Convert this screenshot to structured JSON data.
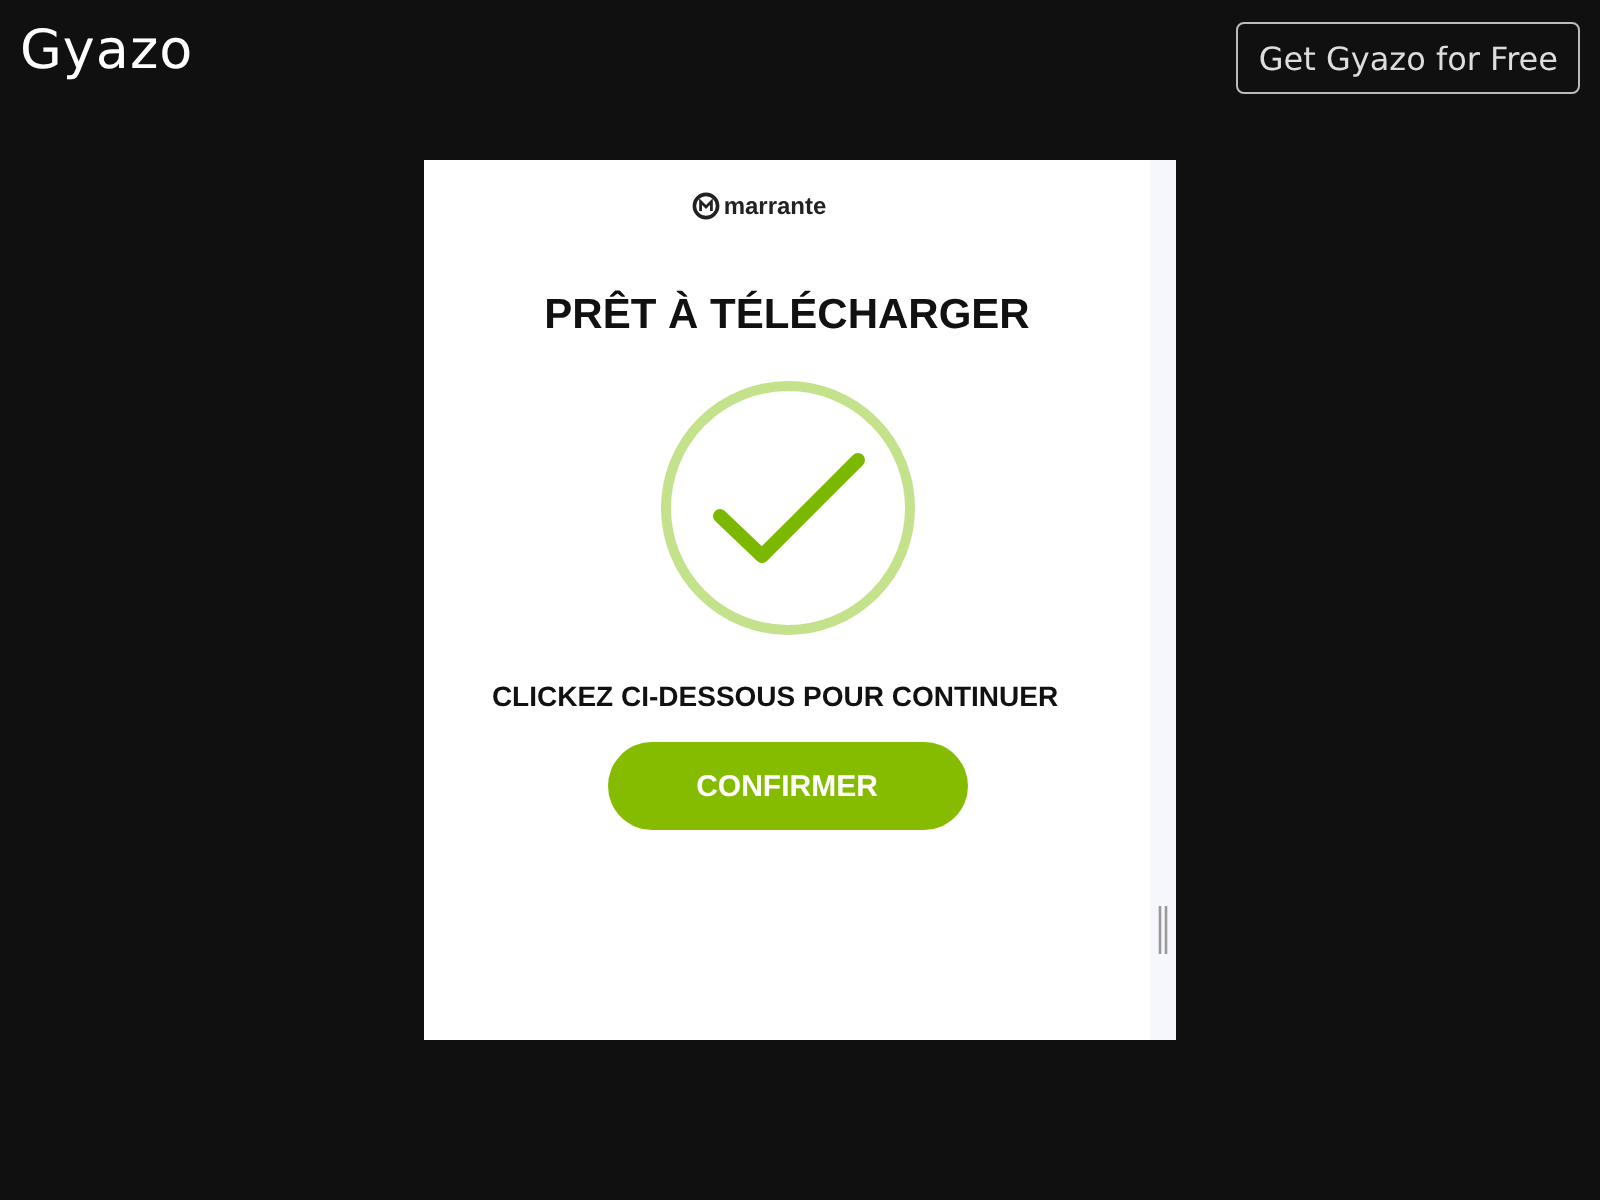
{
  "header": {
    "logo": "Gyazo",
    "cta": "Get Gyazo for Free"
  },
  "screenshot": {
    "brand": "marrante",
    "title": "PRÊT À TÉLÉCHARGER",
    "instruction": "CLICKEZ CI-DESSOUS POUR CONTINUER",
    "button": "CONFIRMER"
  }
}
